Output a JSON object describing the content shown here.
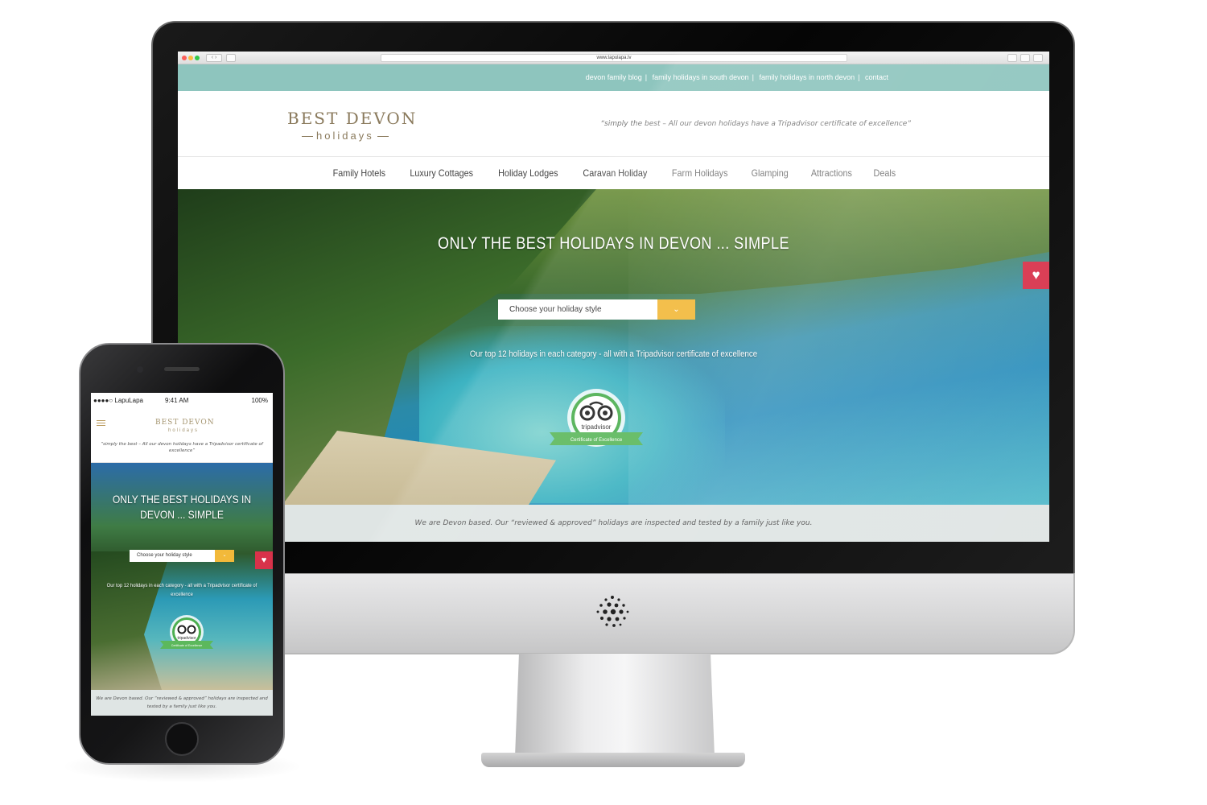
{
  "browser": {
    "url": "www.lapulapa.lv"
  },
  "desktop_site": {
    "top_links": [
      "devon family blog",
      "family holidays in south devon",
      "family holidays in north devon",
      "contact"
    ],
    "top_links_separator": "|",
    "logo": {
      "main_left": "BEST DEV",
      "main_sun": "O",
      "main_right": "N",
      "sub": "holidays"
    },
    "tagline": "“simply the best – All our devon holidays have a Tripadvisor certificate of excellence”",
    "nav": [
      {
        "label": "Family Hotels",
        "muted": false
      },
      {
        "label": "Luxury Cottages",
        "muted": false
      },
      {
        "label": "Holiday Lodges",
        "muted": false
      },
      {
        "label": "Caravan Holiday",
        "muted": false
      },
      {
        "label": "Farm Holidays",
        "muted": true
      },
      {
        "label": "Glamping",
        "muted": true
      },
      {
        "label": "Attractions",
        "muted": true
      },
      {
        "label": "Deals",
        "muted": true
      }
    ],
    "hero": {
      "title": "ONLY THE BEST HOLIDAYS IN DEVON ... SIMPLE",
      "select_placeholder": "Choose your holiday style",
      "select_button_icon": "chevron-down-icon",
      "subtitle": "Our top 12 holidays in each category - all with a Tripadvisor certificate of excellence",
      "badge": {
        "brand": "tripadvisor",
        "ribbon": "Certificate of Excellence"
      },
      "favourite_icon": "heart-icon"
    },
    "about": "We are Devon based. Our “reviewed & approved” holidays are inspected and tested by a family just like you."
  },
  "phone": {
    "status": {
      "carrier": "●●●●○ LapuLapa",
      "time": "9:41 AM",
      "battery": "100%"
    },
    "logo": {
      "main": "BEST DEVON",
      "sub": "holidays"
    },
    "tagline": "“simply the best – All our devon holidays have a Tripadvisor certificate of excellence”",
    "hero": {
      "title": "ONLY THE BEST HOLIDAYS IN DEVON ... SIMPLE",
      "select_placeholder": "Choose your holiday style",
      "subtitle": "Our top 12 holidays in each category - all with a Tripadvisor certificate of excellence",
      "badge": {
        "brand": "tripadvisor",
        "ribbon": "Certificate of Excellence"
      }
    },
    "about": "We are Devon based. Our “reviewed & approved” holidays are inspected and tested by a family just like you."
  },
  "colors": {
    "top_bar": "#8ec5be",
    "logo_gold": "#8a7a5c",
    "select_button": "#f2b93a",
    "heart_button": "#d8324a",
    "about_bar": "#dfe5e4",
    "tripadvisor_green": "#4caf50"
  }
}
